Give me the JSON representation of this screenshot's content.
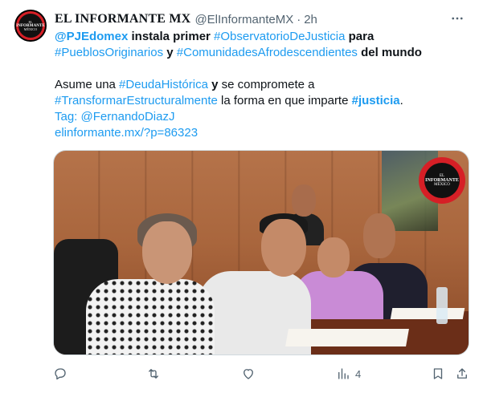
{
  "tweet": {
    "avatar": {
      "lines": [
        "EL",
        "INFORMANTE",
        "MÉXICO"
      ],
      "colors": {
        "ring": "#d61f26",
        "center": "#111111"
      }
    },
    "author": {
      "display_name": "EL INFORMANTE MX",
      "handle": "@ElInformanteMX",
      "separator": "·",
      "time": "2h"
    },
    "more_icon": "more-horizontal-icon",
    "text": {
      "line1": [
        {
          "text": "@PJEdomex",
          "style": "mention-bold"
        },
        {
          "text": " instala primer ",
          "style": "bold"
        },
        {
          "text": "#ObservatorioDeJusticia",
          "style": "hashtag"
        },
        {
          "text": " para",
          "style": "bold"
        }
      ],
      "line2": [
        {
          "text": "#PueblosOriginarios",
          "style": "hashtag"
        },
        {
          "text": " y ",
          "style": "bold"
        },
        {
          "text": "#ComunidadesAfrodescendientes",
          "style": "hashtag"
        },
        {
          "text": " del mundo",
          "style": "bold"
        }
      ],
      "line3": [
        {
          "text": "Asume una ",
          "style": "normal"
        },
        {
          "text": "#DeudaHistórica",
          "style": "hashtag"
        },
        {
          "text": " y",
          "style": "bold"
        },
        {
          "text": " se compromete a",
          "style": "normal"
        }
      ],
      "line4": [
        {
          "text": "#TransformarEstructuralmente",
          "style": "hashtag"
        },
        {
          "text": " la forma en que imparte ",
          "style": "normal"
        },
        {
          "text": "#justicia",
          "style": "hashtag-bold"
        },
        {
          "text": ".",
          "style": "normal"
        }
      ],
      "line5": [
        {
          "text": "Tag: ",
          "style": "link"
        },
        {
          "text": "@FernandoDiazJ",
          "style": "hashtag"
        }
      ],
      "link": "elinformante.mx/?p=86323"
    },
    "media": {
      "logo_lines": [
        "EL",
        "INFORMANTE",
        "MÉXICO"
      ]
    },
    "actions": {
      "reply_icon": "reply-icon",
      "retweet_icon": "retweet-icon",
      "like_icon": "heart-icon",
      "views_icon": "views-bar-chart-icon",
      "views_count": "4",
      "bookmark_icon": "bookmark-icon",
      "share_icon": "share-icon"
    },
    "colors": {
      "link": "#1d9bf0",
      "text": "#0f1419",
      "muted": "#536471"
    }
  }
}
